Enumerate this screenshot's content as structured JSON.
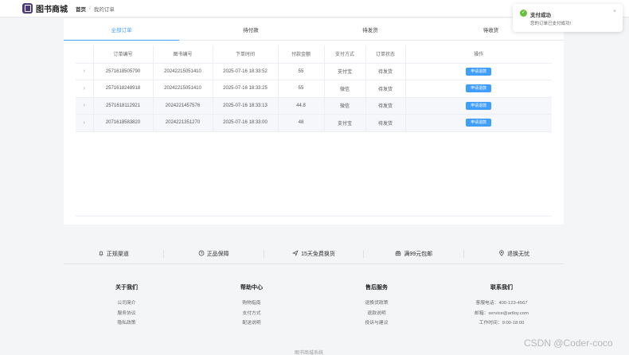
{
  "header": {
    "app_name": "图书商城",
    "breadcrumb_home": "首页",
    "breadcrumb_sep": "/",
    "breadcrumb_current": "我的订单"
  },
  "tabs": [
    "全部订单",
    "待付款",
    "待发货",
    "待收货"
  ],
  "columns": [
    "订单编号",
    "图书编号",
    "下单时间",
    "付款金额",
    "支付方式",
    "订单状态",
    "操作"
  ],
  "orders": [
    {
      "order_no": "2571618505790",
      "book_no": "20242215051410",
      "time": "2025-07-16 18:33:52",
      "amount": "55",
      "pay": "支付宝",
      "status": "待发货",
      "action": "申请退款"
    },
    {
      "order_no": "2571618248918",
      "book_no": "20242215051410",
      "time": "2025-07-16 18:33:25",
      "amount": "55",
      "pay": "微信",
      "status": "待发货",
      "action": "申请退款"
    },
    {
      "order_no": "2571618112921",
      "book_no": "2024221457576",
      "time": "2025-07-16 18:33:13",
      "amount": "44.8",
      "pay": "微信",
      "status": "待发货",
      "action": "申请退款"
    },
    {
      "order_no": "2071618583820",
      "book_no": "2024221351270",
      "time": "2025-07-16 18:33:00",
      "amount": "48",
      "pay": "支付宝",
      "status": "待发货",
      "action": "申请退款"
    }
  ],
  "features": [
    {
      "icon": "bell-icon",
      "label": "正规渠道"
    },
    {
      "icon": "clock-icon",
      "label": "正品保障"
    },
    {
      "icon": "send-icon",
      "label": "15天免费换货"
    },
    {
      "icon": "gift-icon",
      "label": "满99元包邮"
    },
    {
      "icon": "location-icon",
      "label": "退换无忧"
    }
  ],
  "footer": {
    "about": {
      "title": "关于我们",
      "links": [
        "公司简介",
        "服务协议",
        "隐私政策"
      ]
    },
    "help": {
      "title": "帮助中心",
      "links": [
        "购物指南",
        "支付方式",
        "配送说明"
      ]
    },
    "after": {
      "title": "售后服务",
      "links": [
        "退换货政策",
        "退款说明",
        "投诉与建议"
      ]
    },
    "contact": {
      "title": "联系我们",
      "links": [
        "客服电话：400-123-4567",
        "邮箱：service@artloy.com",
        "工作时间：9:00-18:00"
      ]
    },
    "bottom_text": "图书商城系统"
  },
  "toast": {
    "title": "支付成功",
    "message": "您的订单已支付成功!",
    "close": "×"
  },
  "watermark": "CSDN @Coder-coco",
  "colors": {
    "primary": "#409eff",
    "success": "#67c23a",
    "brand": "#4a3a7a"
  }
}
